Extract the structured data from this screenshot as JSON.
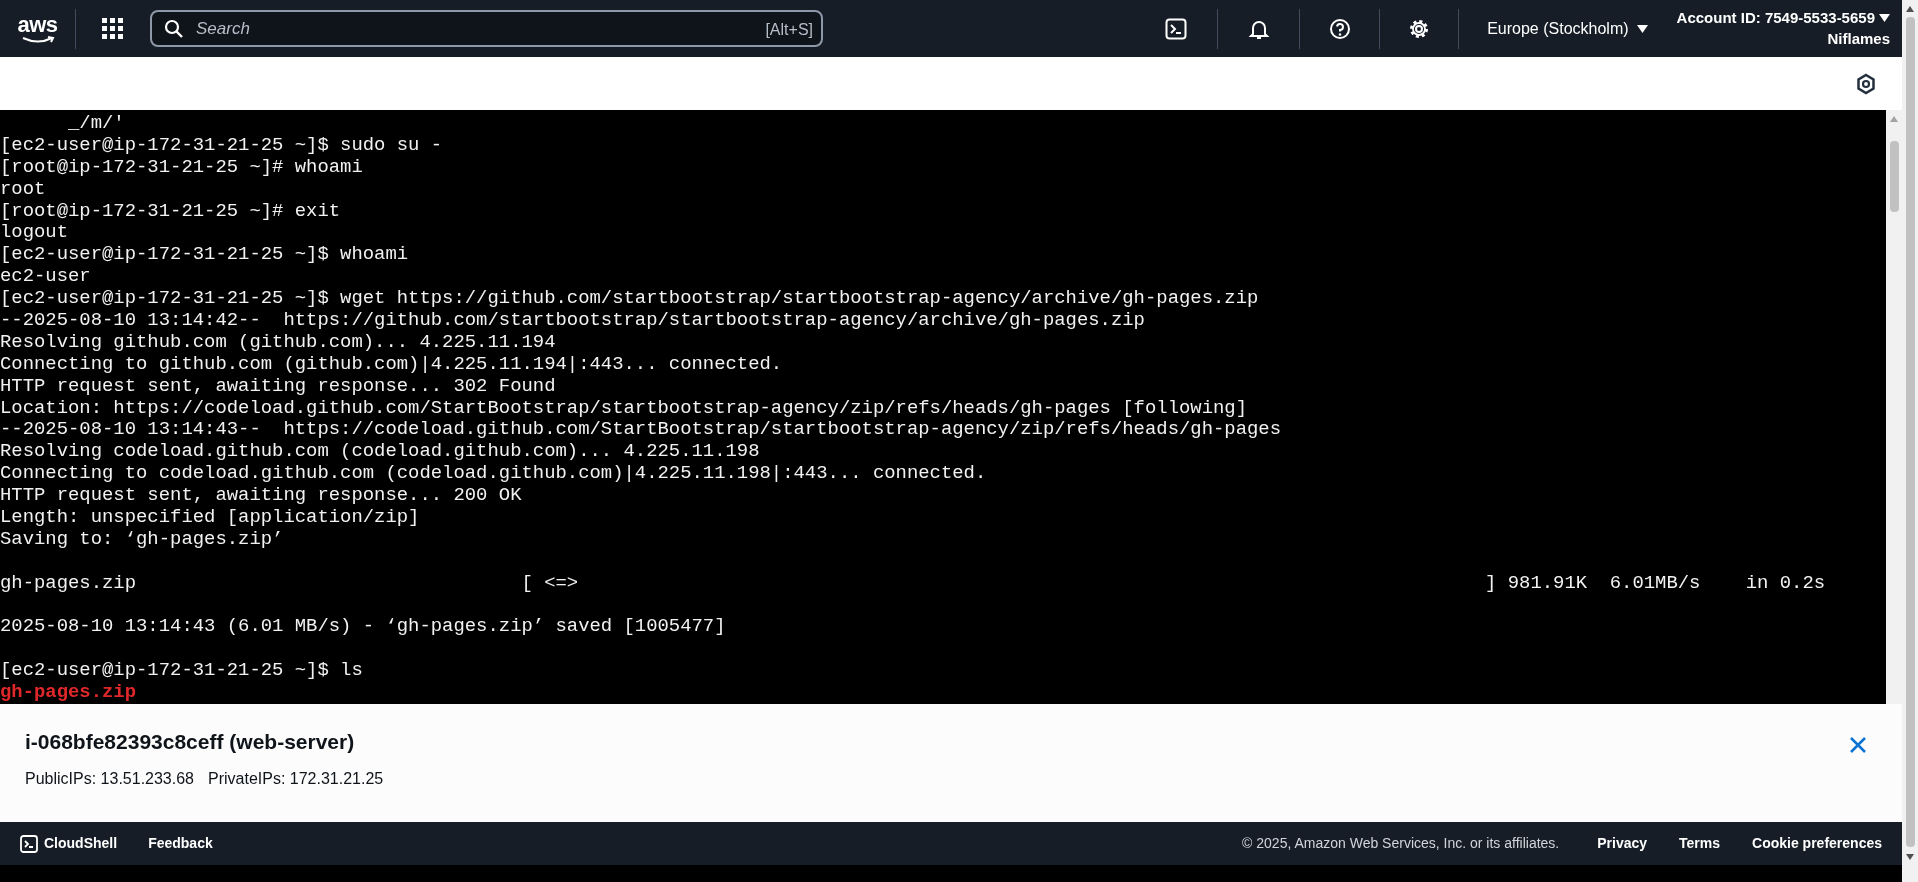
{
  "top_nav": {
    "logo": "aws",
    "search": {
      "placeholder": "Search",
      "shortcut": "[Alt+S]"
    },
    "region": "Europe (Stockholm)",
    "account_id": "Account ID: 7549-5533-5659",
    "user": "Niflames"
  },
  "terminal": {
    "blocks": [
      {
        "lines": [
          {
            "kind": "output",
            "text": "      _/m/'"
          },
          {
            "kind": "output",
            "text": "[ec2-user@ip-172-31-21-25 ~]$ sudo su -"
          },
          {
            "kind": "output",
            "text": "[root@ip-172-31-21-25 ~]# whoami"
          },
          {
            "kind": "output",
            "text": "root"
          },
          {
            "kind": "output",
            "text": "[root@ip-172-31-21-25 ~]# exit"
          },
          {
            "kind": "output",
            "text": "logout"
          },
          {
            "kind": "output",
            "text": "[ec2-user@ip-172-31-21-25 ~]$ whoami"
          },
          {
            "kind": "output",
            "text": "ec2-user"
          },
          {
            "kind": "output",
            "text": "[ec2-user@ip-172-31-21-25 ~]$ wget https://github.com/startbootstrap/startbootstrap-agency/archive/gh-pages.zip"
          },
          {
            "kind": "output",
            "text": "--2025-08-10 13:14:42--  https://github.com/startbootstrap/startbootstrap-agency/archive/gh-pages.zip"
          },
          {
            "kind": "output",
            "text": "Resolving github.com (github.com)... 4.225.11.194"
          },
          {
            "kind": "output",
            "text": "Connecting to github.com (github.com)|4.225.11.194|:443... connected."
          },
          {
            "kind": "output",
            "text": "HTTP request sent, awaiting response... 302 Found"
          },
          {
            "kind": "output",
            "text": "Location: https://codeload.github.com/StartBootstrap/startbootstrap-agency/zip/refs/heads/gh-pages [following]"
          },
          {
            "kind": "output",
            "text": "--2025-08-10 13:14:43--  https://codeload.github.com/StartBootstrap/startbootstrap-agency/zip/refs/heads/gh-pages"
          },
          {
            "kind": "output",
            "text": "Resolving codeload.github.com (codeload.github.com)... 4.225.11.198"
          },
          {
            "kind": "output",
            "text": "Connecting to codeload.github.com (codeload.github.com)|4.225.11.198|:443... connected."
          },
          {
            "kind": "output",
            "text": "HTTP request sent, awaiting response... 200 OK"
          },
          {
            "kind": "output",
            "text": "Length: unspecified [application/zip]"
          },
          {
            "kind": "output",
            "text": "Saving to: ‘gh-pages.zip’"
          }
        ]
      },
      {
        "lines": [
          {
            "kind": "output",
            "text": "gh-pages.zip                                  [ <=>                                                                                ] 981.91K  6.01MB/s    in 0.2s"
          }
        ]
      },
      {
        "lines": [
          {
            "kind": "output",
            "text": "2025-08-10 13:14:43 (6.01 MB/s) - ‘gh-pages.zip’ saved [1005477]"
          }
        ]
      },
      {
        "lines": [
          {
            "kind": "output",
            "text": "[ec2-user@ip-172-31-21-25 ~]$ ls"
          },
          {
            "kind": "file",
            "text": "gh-pages.zip"
          }
        ]
      }
    ]
  },
  "instance_panel": {
    "title": "i-068bfe82393c8ceff (web-server)",
    "public_ips": "PublicIPs: 13.51.233.68",
    "private_ips": "PrivateIPs: 172.31.21.25"
  },
  "footer": {
    "cloudshell": "CloudShell",
    "feedback": "Feedback",
    "copyright": "© 2025, Amazon Web Services, Inc. or its affiliates.",
    "links": [
      "Privacy",
      "Terms",
      "Cookie preferences"
    ]
  }
}
